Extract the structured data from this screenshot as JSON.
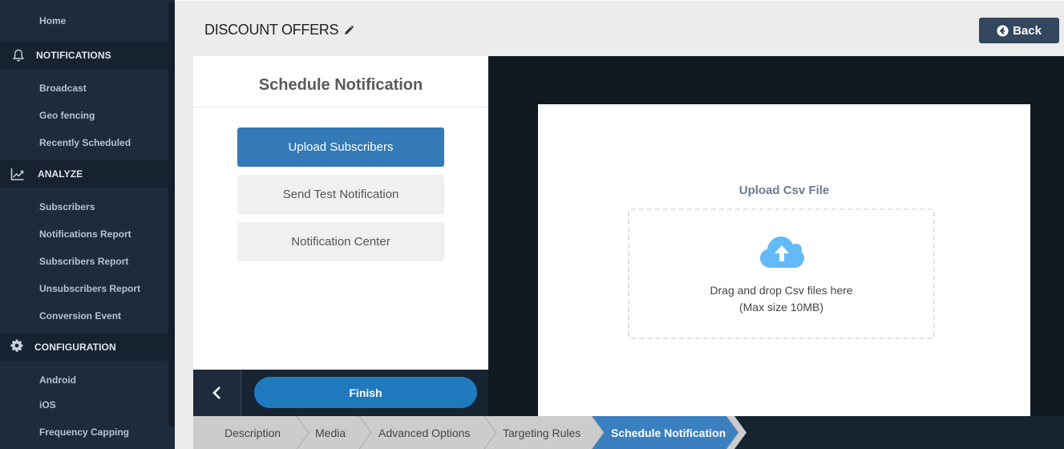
{
  "sidebar": {
    "home": "Home",
    "sections": [
      {
        "icon": "bell-icon",
        "label": "NOTIFICATIONS",
        "items": [
          "Broadcast",
          "Geo fencing",
          "Recently Scheduled"
        ]
      },
      {
        "icon": "chart-line-icon",
        "label": "ANALYZE",
        "items": [
          "Subscribers",
          "Notifications Report",
          "Subscribers Report",
          "Unsubscribers Report",
          "Conversion Event"
        ]
      },
      {
        "icon": "gear-icon",
        "label": "CONFIGURATION",
        "items": [
          "Android",
          "iOS",
          "Frequency Capping"
        ]
      }
    ]
  },
  "header": {
    "title": "DISCOUNT OFFERS",
    "back_label": "Back"
  },
  "left_panel": {
    "title": "Schedule Notification",
    "options": [
      {
        "label": "Upload Subscribers",
        "active": true
      },
      {
        "label": "Send Test Notification",
        "active": false
      },
      {
        "label": "Notification Center",
        "active": false
      }
    ],
    "finish_label": "Finish"
  },
  "upload": {
    "title": "Upload Csv File",
    "drop_text": "Drag and drop Csv files here",
    "size_text": "(Max size 10MB)"
  },
  "steps": [
    {
      "label": "Description",
      "active": false
    },
    {
      "label": "Media",
      "active": false
    },
    {
      "label": "Advanced Options",
      "active": false
    },
    {
      "label": "Targeting Rules",
      "active": false
    },
    {
      "label": "Schedule Notification",
      "active": true
    }
  ],
  "colors": {
    "sidebar_bg": "#1e2b3d",
    "primary": "#337ab7",
    "finish": "#1f7abd",
    "back_btn": "#33475f",
    "cloud": "#64b9f7"
  }
}
